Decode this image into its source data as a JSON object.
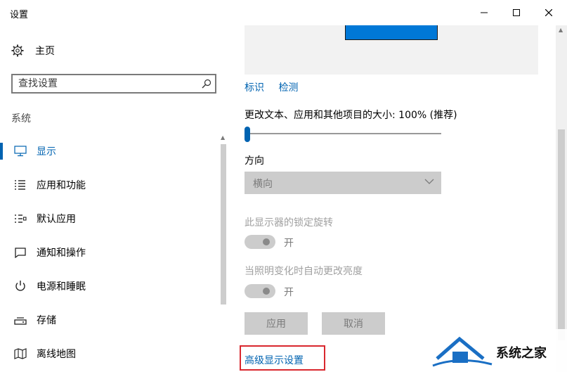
{
  "window": {
    "title": "设置"
  },
  "sidebar": {
    "home_label": "主页",
    "search_placeholder": "查找设置",
    "section_label": "系统",
    "items": [
      {
        "label": "显示",
        "icon": "monitor-icon",
        "active": true
      },
      {
        "label": "应用和功能",
        "icon": "list-icon",
        "active": false
      },
      {
        "label": "默认应用",
        "icon": "default-apps-icon",
        "active": false
      },
      {
        "label": "通知和操作",
        "icon": "notification-icon",
        "active": false
      },
      {
        "label": "电源和睡眠",
        "icon": "power-icon",
        "active": false
      },
      {
        "label": "存储",
        "icon": "storage-icon",
        "active": false
      },
      {
        "label": "离线地图",
        "icon": "map-icon",
        "active": false
      }
    ]
  },
  "main": {
    "identify_link": "标识",
    "detect_link": "检测",
    "scale_label": "更改文本、应用和其他项目的大小: 100% (推荐)",
    "scale_value_percent": 100,
    "orientation_label": "方向",
    "orientation_value": "横向",
    "rotation_lock_label": "此显示器的锁定旋转",
    "rotation_lock_state": "开",
    "auto_brightness_label": "当照明变化时自动更改亮度",
    "auto_brightness_state": "开",
    "apply_button": "应用",
    "cancel_button": "取消",
    "advanced_link": "高级显示设置"
  },
  "watermark": {
    "text": "系统之家"
  },
  "colors": {
    "accent": "#0063b1",
    "highlight_box": "#d9272e",
    "monitor": "#0078d7"
  }
}
